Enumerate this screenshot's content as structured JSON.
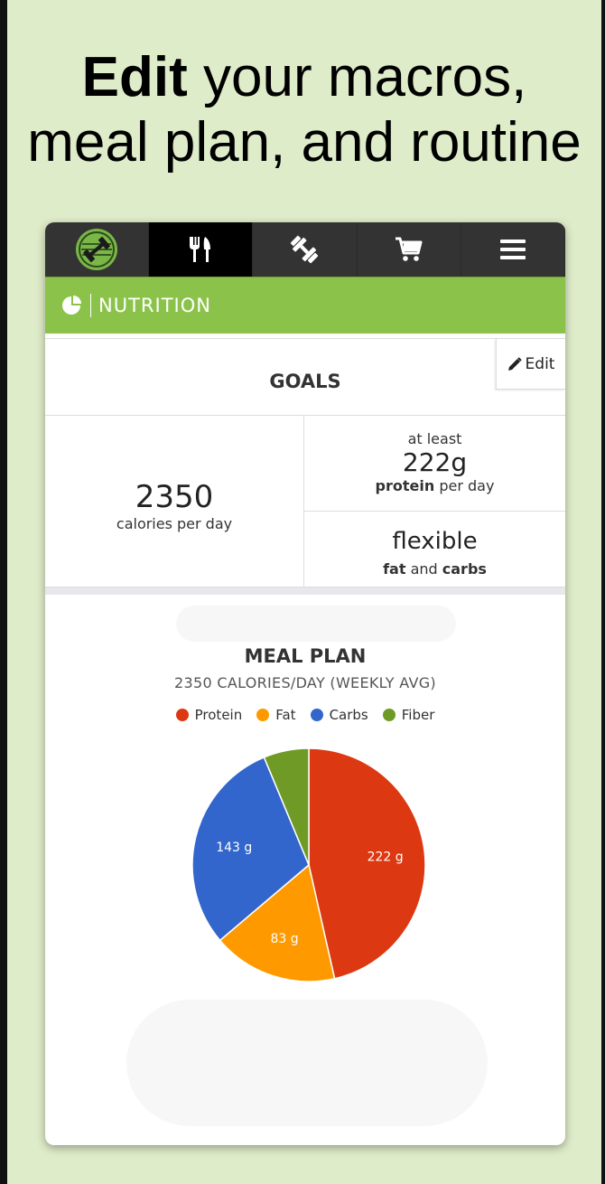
{
  "headline": {
    "bold": "Edit",
    "line1_rest": " your macros,",
    "line2": "meal plan, and routine"
  },
  "nav": {
    "items": [
      {
        "name": "logo",
        "icon": "dumbbell-logo-icon"
      },
      {
        "name": "nutrition",
        "icon": "fork-knife-icon",
        "active": true
      },
      {
        "name": "workout",
        "icon": "dumbbell-icon"
      },
      {
        "name": "shop",
        "icon": "cart-icon"
      },
      {
        "name": "menu",
        "icon": "hamburger-menu-icon"
      }
    ]
  },
  "section": {
    "title": "NUTRITION",
    "icon": "pie-chart-icon"
  },
  "goals": {
    "title": "GOALS",
    "edit_label": "Edit",
    "calories": {
      "value": "2350",
      "label": "calories per day"
    },
    "protein": {
      "prefix": "at least",
      "value": "222g",
      "bold": "protein",
      "suffix": " per day"
    },
    "other": {
      "value": "flexible",
      "bold1": "fat",
      "middle": " and ",
      "bold2": "carbs"
    }
  },
  "meal_plan": {
    "title": "MEAL PLAN",
    "subtitle": "2350 CALORIES/DAY (WEEKLY AVG)"
  },
  "chart_data": {
    "type": "pie",
    "series": [
      {
        "name": "Protein",
        "value": 222,
        "label": "222 g",
        "color": "#dc3912"
      },
      {
        "name": "Fat",
        "value": 83,
        "label": "83 g",
        "color": "#ff9900"
      },
      {
        "name": "Carbs",
        "value": 143,
        "label": "143 g",
        "color": "#3366cc"
      },
      {
        "name": "Fiber",
        "value": 30,
        "label": "",
        "color": "#6f9a26"
      }
    ],
    "legend": "top"
  },
  "colors": {
    "green": "#8bc34a",
    "nav_bg": "#333333",
    "page_bg": "#dfecc9"
  }
}
